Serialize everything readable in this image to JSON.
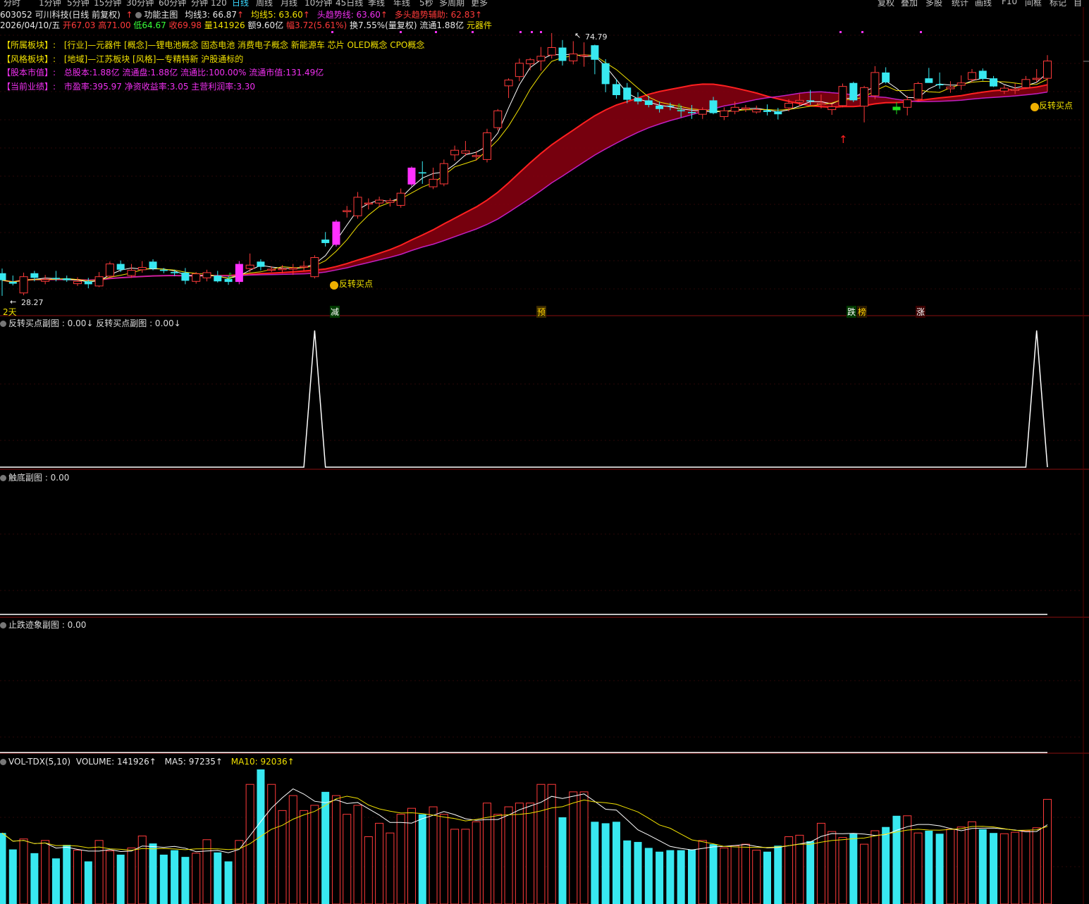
{
  "toolbar": {
    "periods": [
      "分时",
      "1分钟",
      "5分钟",
      "15分钟",
      "30分钟",
      "60分钟",
      "分钟 120",
      "日线",
      "周线",
      "月线",
      "10分钟",
      "45日线",
      "季线",
      "年线",
      "5秒",
      "多周期",
      "更多"
    ],
    "active_period": "日线",
    "tools": [
      "复权",
      "叠加",
      "多股",
      "统计",
      "画线",
      "F10",
      "间框",
      "标记",
      "自选"
    ]
  },
  "header": {
    "stock": "603052 可川科技(日线 前复权)",
    "func_main": "功能主图",
    "ma3_label": "均线3: 66.87",
    "ma5_label": "均线5: 63.60",
    "trend_label": "头趋势线: 63.60",
    "aux_label": "多头趋势辅助: 62.83"
  },
  "quote": {
    "date": "2026/04/10/五",
    "open": "开67.03",
    "high": "高71.00",
    "low": "低64.67",
    "close": "收69.98",
    "volume": "量141926",
    "amount": "额9.60亿",
    "change": "幅3.72(5.61%)",
    "turnover": "换7.55%(量复权)",
    "float": "流通1.88亿",
    "sector": "元器件"
  },
  "info": {
    "l1_key": "【所属板块】:",
    "l1_val": "[行业]—元器件 [概念]—锂电池概念 固态电池 消费电子概念 新能源车 芯片 OLED概念 CPO概念",
    "l2_key": "【风格板块】:",
    "l2_val": "[地域]—江苏板块 [风格]—专精特新 沪股通标的",
    "l3_key": "【股本市值】:",
    "l3_val": "总股本:1.88亿 流通盘:1.88亿 流通比:100.00% 流通市值:131.49亿",
    "l4_key": "【当前业绩】:",
    "l4_val": "市盈率:395.97 净资收益率:3.05 主营利润率:3.30"
  },
  "annotations": {
    "high_price": "74.79",
    "low_price": "28.27",
    "buy_point_1": "反转买点",
    "buy_point_2": "反转买点",
    "left_days": "2天",
    "markers": [
      "减",
      "预",
      "跌",
      "榜",
      "涨"
    ]
  },
  "panes": {
    "reversal": "反转买点副图 : 0.00↓  反转买点副图 : 0.00↓",
    "touch_bottom": "触底副图 : 0.00",
    "stop_fall": "止跌迹象副图 : 0.00",
    "vol_name": "VOL-TDX(5,10)",
    "vol_volume": "VOLUME: 141926↑",
    "vol_ma5": "MA5: 97235↑",
    "vol_ma10": "MA10: 92036↑"
  },
  "colors": {
    "up": "#ff3a3a",
    "down": "#38e8f0",
    "limit_up": "#ff30ff",
    "ma_white": "#ffffff",
    "ma_yellow": "#f0e000",
    "ribbon": "#8b0010"
  },
  "chart_data": {
    "type": "candlestick",
    "price_range_visible": [
      28.27,
      74.79
    ],
    "candles": [
      {
        "o": 33.4,
        "h": 34.2,
        "l": 29.5,
        "c": 32.2
      },
      {
        "o": 31.9,
        "h": 33.0,
        "l": 31.3,
        "c": 31.6
      },
      {
        "o": 30.0,
        "h": 33.5,
        "l": 29.6,
        "c": 32.8
      },
      {
        "o": 33.4,
        "h": 33.8,
        "l": 32.0,
        "c": 32.6
      },
      {
        "o": 32.0,
        "h": 33.1,
        "l": 31.5,
        "c": 32.3
      },
      {
        "o": 32.6,
        "h": 33.8,
        "l": 32.0,
        "c": 32.5
      },
      {
        "o": 32.5,
        "h": 33.0,
        "l": 31.9,
        "c": 32.2
      },
      {
        "o": 31.6,
        "h": 32.7,
        "l": 31.2,
        "c": 32.0
      },
      {
        "o": 32.0,
        "h": 32.6,
        "l": 30.8,
        "c": 31.5
      },
      {
        "o": 31.2,
        "h": 33.6,
        "l": 31.0,
        "c": 32.8
      },
      {
        "o": 32.9,
        "h": 35.4,
        "l": 32.5,
        "c": 35.0
      },
      {
        "o": 35.0,
        "h": 35.6,
        "l": 33.6,
        "c": 34.0
      },
      {
        "o": 33.0,
        "h": 35.0,
        "l": 32.6,
        "c": 33.9
      },
      {
        "o": 34.0,
        "h": 35.5,
        "l": 33.5,
        "c": 34.4
      },
      {
        "o": 35.4,
        "h": 35.8,
        "l": 33.9,
        "c": 34.2
      },
      {
        "o": 34.0,
        "h": 34.3,
        "l": 33.4,
        "c": 33.8
      },
      {
        "o": 33.6,
        "h": 34.0,
        "l": 32.9,
        "c": 33.4
      },
      {
        "o": 33.5,
        "h": 34.3,
        "l": 31.5,
        "c": 32.1
      },
      {
        "o": 32.0,
        "h": 33.6,
        "l": 31.6,
        "c": 33.3
      },
      {
        "o": 32.6,
        "h": 34.0,
        "l": 32.0,
        "c": 33.5
      },
      {
        "o": 33.0,
        "h": 33.8,
        "l": 31.8,
        "c": 32.0
      },
      {
        "o": 32.4,
        "h": 32.9,
        "l": 31.4,
        "c": 31.9
      },
      {
        "o": 31.9,
        "h": 35.5,
        "l": 31.5,
        "c": 35.0
      },
      {
        "o": 34.2,
        "h": 36.8,
        "l": 33.6,
        "c": 34.8
      },
      {
        "o": 35.4,
        "h": 35.8,
        "l": 33.9,
        "c": 34.5
      },
      {
        "o": 34.0,
        "h": 34.6,
        "l": 33.6,
        "c": 34.1
      },
      {
        "o": 34.0,
        "h": 34.8,
        "l": 33.4,
        "c": 34.2
      },
      {
        "o": 34.1,
        "h": 35.0,
        "l": 33.1,
        "c": 34.3
      },
      {
        "o": 34.5,
        "h": 35.5,
        "l": 33.8,
        "c": 34.6
      },
      {
        "o": 32.8,
        "h": 36.5,
        "l": 32.5,
        "c": 36.1
      },
      {
        "o": 39.2,
        "h": 40.5,
        "l": 38.0,
        "c": 38.6
      },
      {
        "o": 38.3,
        "h": 42.6,
        "l": 38.0,
        "c": 42.3
      },
      {
        "o": 44.0,
        "h": 45.0,
        "l": 43.0,
        "c": 44.2
      },
      {
        "o": 43.3,
        "h": 47.4,
        "l": 42.8,
        "c": 46.5
      },
      {
        "o": 45.5,
        "h": 46.3,
        "l": 44.4,
        "c": 45.5
      },
      {
        "o": 45.5,
        "h": 46.6,
        "l": 44.9,
        "c": 46.0
      },
      {
        "o": 45.6,
        "h": 46.3,
        "l": 44.9,
        "c": 45.9
      },
      {
        "o": 45.1,
        "h": 48.0,
        "l": 44.7,
        "c": 47.2
      },
      {
        "o": 48.7,
        "h": 51.8,
        "l": 48.4,
        "c": 51.6
      },
      {
        "o": 50.8,
        "h": 52.7,
        "l": 48.8,
        "c": 50.6
      },
      {
        "o": 48.3,
        "h": 51.6,
        "l": 47.9,
        "c": 49.6
      },
      {
        "o": 48.8,
        "h": 53.0,
        "l": 48.4,
        "c": 52.3
      },
      {
        "o": 53.8,
        "h": 55.4,
        "l": 52.8,
        "c": 54.6
      },
      {
        "o": 54.1,
        "h": 56.2,
        "l": 53.6,
        "c": 54.5
      },
      {
        "o": 53.5,
        "h": 54.4,
        "l": 52.8,
        "c": 53.7
      },
      {
        "o": 53.0,
        "h": 58.3,
        "l": 52.5,
        "c": 57.6
      },
      {
        "o": 58.5,
        "h": 61.7,
        "l": 58.0,
        "c": 61.4
      },
      {
        "o": 65.7,
        "h": 67.0,
        "l": 63.6,
        "c": 66.7
      },
      {
        "o": 67.3,
        "h": 70.4,
        "l": 66.5,
        "c": 69.6
      },
      {
        "o": 69.5,
        "h": 70.5,
        "l": 68.4,
        "c": 70.2
      },
      {
        "o": 70.0,
        "h": 72.4,
        "l": 68.3,
        "c": 70.8
      },
      {
        "o": 71.0,
        "h": 74.8,
        "l": 70.4,
        "c": 72.3
      },
      {
        "o": 72.3,
        "h": 73.6,
        "l": 69.2,
        "c": 70.0
      },
      {
        "o": 70.0,
        "h": 73.4,
        "l": 69.4,
        "c": 71.2
      },
      {
        "o": 71.0,
        "h": 73.2,
        "l": 69.0,
        "c": 71.0
      },
      {
        "o": 72.7,
        "h": 72.8,
        "l": 67.7,
        "c": 70.2
      },
      {
        "o": 69.6,
        "h": 70.3,
        "l": 64.6,
        "c": 66.0
      },
      {
        "o": 66.0,
        "h": 66.9,
        "l": 63.5,
        "c": 64.1
      },
      {
        "o": 65.4,
        "h": 66.2,
        "l": 62.7,
        "c": 63.3
      },
      {
        "o": 63.6,
        "h": 64.6,
        "l": 62.5,
        "c": 63.0
      },
      {
        "o": 63.2,
        "h": 64.0,
        "l": 62.0,
        "c": 62.4
      },
      {
        "o": 62.3,
        "h": 63.0,
        "l": 61.1,
        "c": 61.7
      },
      {
        "o": 62.3,
        "h": 62.8,
        "l": 61.5,
        "c": 62.1
      },
      {
        "o": 61.5,
        "h": 62.3,
        "l": 60.3,
        "c": 61.4
      },
      {
        "o": 61.2,
        "h": 62.4,
        "l": 60.0,
        "c": 61.0
      },
      {
        "o": 60.8,
        "h": 62.0,
        "l": 60.0,
        "c": 61.6
      },
      {
        "o": 63.2,
        "h": 63.8,
        "l": 60.8,
        "c": 61.0
      },
      {
        "o": 60.4,
        "h": 62.0,
        "l": 59.8,
        "c": 61.4
      },
      {
        "o": 61.3,
        "h": 63.0,
        "l": 60.8,
        "c": 62.0
      },
      {
        "o": 61.7,
        "h": 62.4,
        "l": 61.2,
        "c": 61.9
      },
      {
        "o": 61.2,
        "h": 62.3,
        "l": 60.9,
        "c": 61.6
      },
      {
        "o": 61.5,
        "h": 62.5,
        "l": 60.6,
        "c": 61.2
      },
      {
        "o": 61.3,
        "h": 61.9,
        "l": 59.9,
        "c": 60.8
      },
      {
        "o": 61.9,
        "h": 63.4,
        "l": 61.3,
        "c": 62.7
      },
      {
        "o": 62.9,
        "h": 64.3,
        "l": 62.2,
        "c": 63.2
      },
      {
        "o": 63.2,
        "h": 65.0,
        "l": 62.4,
        "c": 63.0
      },
      {
        "o": 62.5,
        "h": 64.2,
        "l": 61.8,
        "c": 62.7
      },
      {
        "o": 61.6,
        "h": 62.6,
        "l": 60.7,
        "c": 62.1
      },
      {
        "o": 62.3,
        "h": 66.1,
        "l": 62.0,
        "c": 65.6
      },
      {
        "o": 66.2,
        "h": 66.4,
        "l": 62.9,
        "c": 63.2
      },
      {
        "o": 62.2,
        "h": 65.7,
        "l": 59.4,
        "c": 65.4
      },
      {
        "o": 64.0,
        "h": 69.1,
        "l": 63.4,
        "c": 68.0
      },
      {
        "o": 68.0,
        "h": 68.9,
        "l": 66.1,
        "c": 66.3
      },
      {
        "o": 62.1,
        "h": 62.9,
        "l": 60.8,
        "c": 61.5
      },
      {
        "o": 62.0,
        "h": 64.0,
        "l": 60.6,
        "c": 63.3
      },
      {
        "o": 63.4,
        "h": 66.4,
        "l": 63.0,
        "c": 66.1
      },
      {
        "o": 67.0,
        "h": 68.8,
        "l": 66.3,
        "c": 66.2
      },
      {
        "o": 66.0,
        "h": 68.0,
        "l": 65.2,
        "c": 65.8
      },
      {
        "o": 65.2,
        "h": 66.5,
        "l": 64.5,
        "c": 65.5
      },
      {
        "o": 65.8,
        "h": 67.5,
        "l": 65.0,
        "c": 66.2
      },
      {
        "o": 66.8,
        "h": 68.6,
        "l": 66.3,
        "c": 68.0
      },
      {
        "o": 68.3,
        "h": 68.7,
        "l": 66.6,
        "c": 66.9
      },
      {
        "o": 67.0,
        "h": 67.4,
        "l": 65.5,
        "c": 65.6
      },
      {
        "o": 64.8,
        "h": 65.8,
        "l": 64.3,
        "c": 65.3
      },
      {
        "o": 64.9,
        "h": 66.1,
        "l": 64.3,
        "c": 65.1
      },
      {
        "o": 65.4,
        "h": 67.4,
        "l": 65.2,
        "c": 66.8
      },
      {
        "o": 66.8,
        "h": 68.6,
        "l": 66.3,
        "c": 67.0
      },
      {
        "o": 67.0,
        "h": 71.0,
        "l": 64.7,
        "c": 69.98
      }
    ],
    "volume": [
      95,
      73,
      87,
      68,
      85,
      61,
      79,
      72,
      57,
      85,
      71,
      66,
      75,
      91,
      81,
      66,
      72,
      63,
      68,
      86,
      69,
      57,
      85,
      160,
      180,
      160,
      125,
      145,
      125,
      132,
      150,
      145,
      120,
      132,
      90,
      108,
      95,
      120,
      128,
      120,
      130,
      120,
      100,
      100,
      110,
      135,
      120,
      130,
      135,
      135,
      160,
      160,
      116,
      150,
      150,
      110,
      108,
      110,
      85,
      83,
      75,
      70,
      72,
      72,
      73,
      85,
      80,
      75,
      78,
      80,
      72,
      70,
      78,
      90,
      92,
      84,
      108,
      97,
      89,
      94,
      80,
      98,
      103,
      118,
      118,
      95,
      98,
      94,
      100,
      103,
      110,
      100,
      95,
      94,
      96,
      98,
      102,
      140
    ],
    "reversal_signal_indices": [
      29,
      96
    ]
  }
}
